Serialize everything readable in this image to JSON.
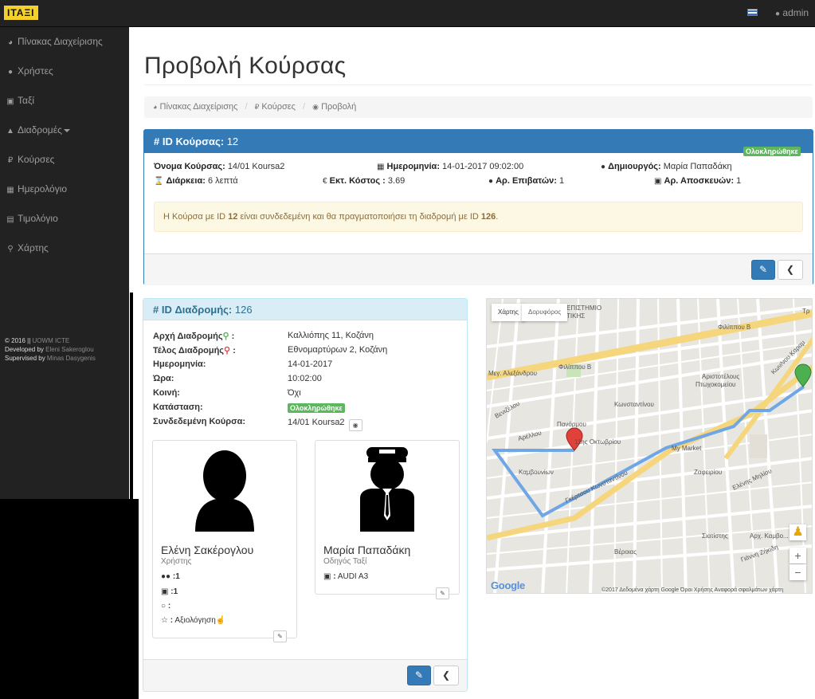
{
  "topbar": {
    "brand": "ITAΞI",
    "user": "admin"
  },
  "sidebar": {
    "items": [
      {
        "label": "Πίνακας Διαχείρισης",
        "icon": "tachometer-icon"
      },
      {
        "label": "Χρήστες",
        "icon": "users-icon"
      },
      {
        "label": "Ταξί",
        "icon": "car-icon"
      },
      {
        "label": "Διαδρομές",
        "icon": "road-icon"
      },
      {
        "label": "Κούρσες",
        "icon": "ruble-icon"
      },
      {
        "label": "Ημερολόγιο",
        "icon": "calendar-icon"
      },
      {
        "label": "Τιμολόγιο",
        "icon": "file-icon"
      },
      {
        "label": "Χάρτης",
        "icon": "map-marker-icon"
      }
    ],
    "footer": {
      "line1_a": "© 2016 || ",
      "line1_b": "UOWM ICTE",
      "line2_a": "Developed by ",
      "line2_b": "Eleni Sakeroglou",
      "line3_a": "Supervised by ",
      "line3_b": "Minas Dasygenis"
    }
  },
  "page": {
    "title": "Προβολή Κούρσας"
  },
  "breadcrumb": {
    "home": "Πίνακας Διαχείρισης",
    "section": "Κούρσες",
    "current": "Προβολή"
  },
  "ride": {
    "header_label": "ID Κούρσας:",
    "id": "12",
    "status": "Ολοκληρώθηκε",
    "name_label": "Όνομα Κούρσας:",
    "name": "14/01 Koursa2",
    "date_label": "Ημερομηνία:",
    "date": "14-01-2017 09:02:00",
    "creator_label": "Δημιουργός:",
    "creator": "Μαρία Παπαδάκη",
    "duration_label": "Διάρκεια:",
    "duration": "6 λεπτά",
    "cost_label": "Εκτ. Κόστος :",
    "cost": "3.69",
    "passengers_label": "Αρ. Επιβατών:",
    "passengers": "1",
    "luggage_label": "Αρ. Αποσκευών:",
    "luggage": "1",
    "alert_a": "Η Κούρσα με ID ",
    "alert_id": "12",
    "alert_b": " είναι συνδεδεμένη και θα πραγματοποιήσει τη διαδρομή με ID ",
    "alert_route": "126",
    "alert_c": "."
  },
  "route": {
    "header_label": "ID Διαδρομής:",
    "id": "126",
    "start_label": "Αρχή Διαδρομής",
    "start": "Καλλιόπης 11, Κοζάνη",
    "end_label": "Τέλος Διαδρομής",
    "end": "Εθνομαρτύρων 2, Κοζάνη",
    "date_label": "Ημερομηνία:",
    "date": "14-01-2017",
    "time_label": "Ώρα:",
    "time": "10:02:00",
    "shared_label": "Κοινή:",
    "shared": "Όχι",
    "status_label": "Κατάσταση:",
    "status": "Ολοκληρώθηκε",
    "linked_label": "Συνδεδεμένη Κούρσα:",
    "linked": "14/01 Koursa2"
  },
  "passenger_card": {
    "name": "Ελένη Σακέρογλου",
    "role": "Χρήστης",
    "passengers": ":1",
    "luggage": ":1",
    "comment": ":",
    "rating_label": "Αξιολόγηση"
  },
  "driver_card": {
    "name": "Μαρία Παπαδάκη",
    "role": "Οδηγός Ταξί",
    "car": "AUDI A3"
  },
  "map": {
    "tab_map": "Χάρτης",
    "tab_satellite": "Δορυφόρος",
    "attribution": "©2017 Δεδομένα χάρτη Google     Όροι Χρήσης     Αναφορά σφαλμάτων χάρτη",
    "zoom_in": "+",
    "zoom_out": "−",
    "logo": "Google",
    "marker_a": "A",
    "marker_b": "B",
    "streets": [
      "Φιλίππου Β",
      "Φιλίππου Β",
      "Μεγ. Αλεξάνδρου",
      "Κωνσταντίνου",
      "Αριστοτέλους",
      "Πτωχοκομείου",
      "11ης Οκτωβρίου",
      "Γκέρτσου Κωνσταντίνου",
      "Ελένης Μηλίου",
      "My Market",
      "Πανόρμου",
      "Καμβουνίων",
      "Ζαφειρίου",
      "Βενιζέλου",
      "Σιατίστης",
      "Γιάννη Ζήκιδη",
      "Αρέλλου",
      "Βέροιας",
      "Αρχ. Καμβο...",
      "ΕΠΙΣΤΗΜΙΟ",
      "ΤΙΚΗΣ",
      "Κων/νου Καραμ",
      "Τρ"
    ]
  }
}
